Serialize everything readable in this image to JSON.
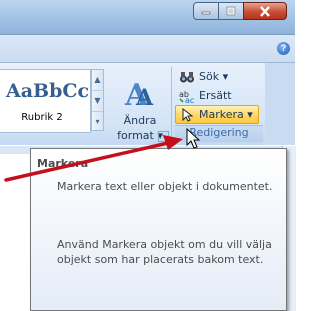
{
  "window": {
    "buttons": [
      {
        "name": "minimize-button",
        "icon": "minimize-icon"
      },
      {
        "name": "maximize-button",
        "icon": "maximize-icon"
      },
      {
        "name": "close-button",
        "icon": "close-icon"
      }
    ]
  },
  "ribbon": {
    "help_icon": "?",
    "styles": {
      "sample_text": "AaBbCc",
      "style_name": "Rubrik 2",
      "change_styles_line1": "Ändra",
      "change_styles_line2": "format ▾"
    },
    "editing": {
      "items": [
        {
          "label": "Sök ▾",
          "icon": "binoculars-icon"
        },
        {
          "label": "Ersätt",
          "icon": "replace-icon"
        },
        {
          "label": "Markera ▾",
          "icon": "select-arrow-icon"
        }
      ],
      "group_label": "Redigering"
    }
  },
  "tooltip": {
    "title": "Markera",
    "paragraph1": "Markera text eller objekt i dokumentet.",
    "paragraph2": "Använd Markera objekt om du vill välja objekt som har placerats bakom text."
  },
  "colors": {
    "accent": "#e3a317",
    "arrow": "#c4101c",
    "tooltip_text": "#4c4c4c",
    "group_label": "#3e6aaa"
  }
}
